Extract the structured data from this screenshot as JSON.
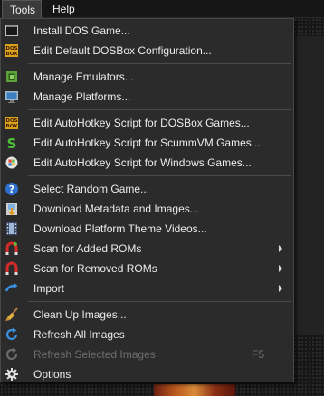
{
  "menubar": {
    "items": [
      {
        "label": "Tools",
        "active": true
      },
      {
        "label": "Help",
        "active": false
      }
    ]
  },
  "menu": {
    "groups": [
      [
        {
          "label": "Install DOS Game...",
          "icon": "terminal-icon"
        },
        {
          "label": "Edit Default DOSBox Configuration...",
          "icon": "dosbox-icon"
        }
      ],
      [
        {
          "label": "Manage Emulators...",
          "icon": "chip-icon"
        },
        {
          "label": "Manage Platforms...",
          "icon": "monitor-icon"
        }
      ],
      [
        {
          "label": "Edit AutoHotkey Script for DOSBox Games...",
          "icon": "dosbox-icon"
        },
        {
          "label": "Edit AutoHotkey Script for ScummVM Games...",
          "icon": "scummvm-icon"
        },
        {
          "label": "Edit AutoHotkey Script for Windows Games...",
          "icon": "windows-icon"
        }
      ],
      [
        {
          "label": "Select Random Game...",
          "icon": "question-icon"
        },
        {
          "label": "Download Metadata and Images...",
          "icon": "download-icon"
        },
        {
          "label": "Download Platform Theme Videos...",
          "icon": "film-icon"
        },
        {
          "label": "Scan for Added ROMs",
          "icon": "magnet-add-icon",
          "submenu": true
        },
        {
          "label": "Scan for Removed ROMs",
          "icon": "magnet-icon",
          "submenu": true
        },
        {
          "label": "Import",
          "icon": "arrow-right-icon",
          "submenu": true
        }
      ],
      [
        {
          "label": "Clean Up Images...",
          "icon": "broom-icon"
        },
        {
          "label": "Refresh All Images",
          "icon": "refresh-icon"
        },
        {
          "label": "Refresh Selected Images",
          "icon": "refresh-disabled-icon",
          "disabled": true,
          "shortcut": "F5"
        },
        {
          "label": "Options",
          "icon": "gear-icon"
        }
      ]
    ]
  },
  "colors": {
    "menu_bg": "#2b2b2b",
    "menubar_bg": "#161616",
    "text": "#ececec",
    "disabled_text": "#6e6e6e"
  }
}
